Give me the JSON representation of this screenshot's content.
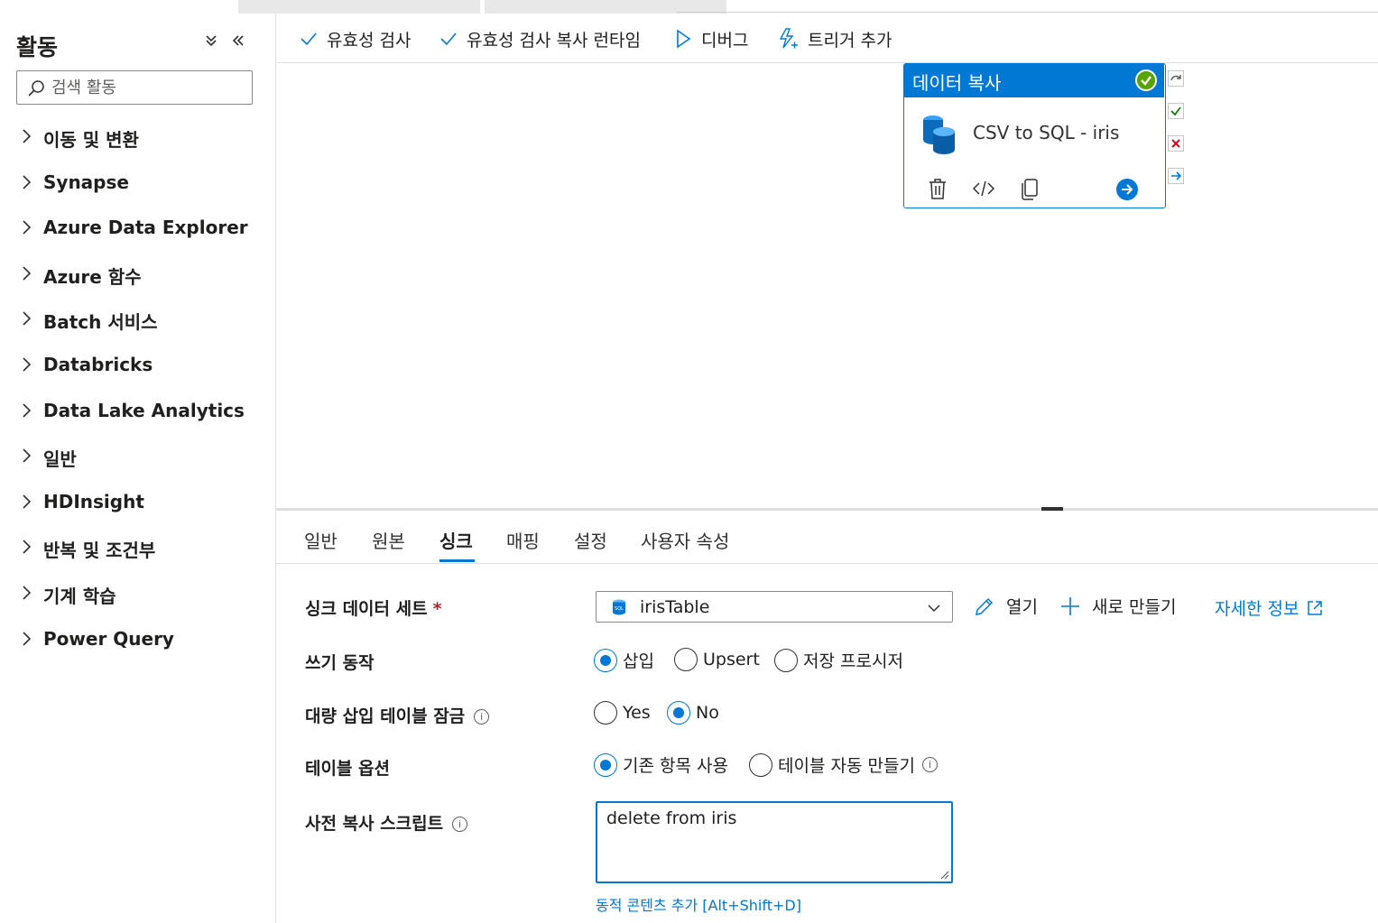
{
  "sidebar": {
    "title": "활동",
    "search_placeholder": "검색 활동",
    "items": [
      {
        "label": "이동 및 변환"
      },
      {
        "label": "Synapse"
      },
      {
        "label": "Azure Data Explorer"
      },
      {
        "label": "Azure 함수"
      },
      {
        "label": "Batch 서비스"
      },
      {
        "label": "Databricks"
      },
      {
        "label": "Data Lake Analytics"
      },
      {
        "label": "일반"
      },
      {
        "label": "HDInsight"
      },
      {
        "label": "반복 및 조건부"
      },
      {
        "label": "기계 학습"
      },
      {
        "label": "Power Query"
      }
    ]
  },
  "toolbar": {
    "validate": "유효성 검사",
    "validate_copy_runtime": "유효성 검사 복사 런타임",
    "debug": "디버그",
    "add_trigger": "트리거 추가"
  },
  "activity": {
    "type_label": "데이터 복사",
    "name": "CSV to SQL - iris",
    "status": "succeeded",
    "header_color": "#0078d4"
  },
  "tabs": [
    {
      "label": "일반"
    },
    {
      "label": "원본"
    },
    {
      "label": "싱크",
      "active": true
    },
    {
      "label": "매핑"
    },
    {
      "label": "설정"
    },
    {
      "label": "사용자 속성"
    }
  ],
  "form": {
    "sink_dataset_label": "싱크 데이터 세트",
    "required_mark": "*",
    "sink_dataset_value": "irisTable",
    "open_label": "열기",
    "new_label": "새로 만들기",
    "learn_more": "자세한 정보",
    "write_behavior_label": "쓰기 동작",
    "write_options": [
      "삽입",
      "Upsert",
      "저장 프로시저"
    ],
    "write_selected": "삽입",
    "bulk_lock_label": "대량 삽입 테이블 잠금",
    "bulk_lock_options": [
      "Yes",
      "No"
    ],
    "bulk_lock_selected": "No",
    "table_option_label": "테이블 옵션",
    "table_options": [
      "기존 항목 사용",
      "테이블 자동 만들기"
    ],
    "table_option_selected": "기존 항목 사용",
    "precopy_label": "사전 복사 스크립트",
    "precopy_value": "delete from iris",
    "dynamic_content_link": "동적 콘텐츠 추가 [Alt+Shift+D]"
  },
  "colors": {
    "accent": "#0078d4",
    "success": "#57a300",
    "error": "#a4262c"
  }
}
